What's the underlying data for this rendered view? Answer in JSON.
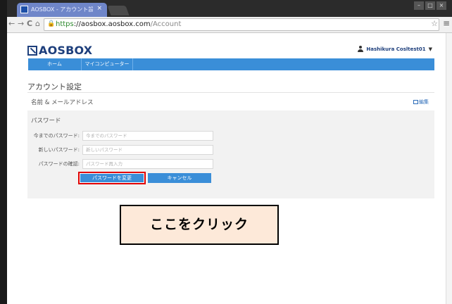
{
  "browser": {
    "tab_title": "AOSBOX - アカウント設定",
    "tab_close": "×",
    "window_buttons": [
      "–",
      "□",
      "×"
    ],
    "nav": {
      "back": "←",
      "forward": "→",
      "reload": "C",
      "home": "⌂"
    },
    "url": {
      "scheme": "https",
      "host": "://aosbox.aosbox.com",
      "path": "/Account"
    },
    "icons": {
      "lock": "lock-icon",
      "star": "star-icon",
      "menu": "menu-icon"
    }
  },
  "header": {
    "logo_text": "AOSBOX",
    "user_name": "Hashikura Cosltest01",
    "user_caret": "▼"
  },
  "nav": {
    "items": [
      "ホーム",
      "マイコンピューター"
    ]
  },
  "page": {
    "title": "アカウント設定",
    "name_email_label": "名前 & メールアドレス",
    "edit_label": "編集"
  },
  "password": {
    "section_title": "パスワード",
    "fields": [
      {
        "label": "今までのパスワード:",
        "placeholder": "今までのパスワード"
      },
      {
        "label": "新しいパスワード:",
        "placeholder": "新しいパスワード"
      },
      {
        "label": "パスワードの確認:",
        "placeholder": "パスワード再入力"
      }
    ],
    "change_button": "パスワードを変更",
    "cancel_button": "キャンセル"
  },
  "callout": {
    "text": "ここをクリック"
  },
  "colors": {
    "brand": "#1e3f7c",
    "nav_blue": "#3a8ed8",
    "highlight_red": "#e00000",
    "callout_bg": "#fde9d9"
  }
}
